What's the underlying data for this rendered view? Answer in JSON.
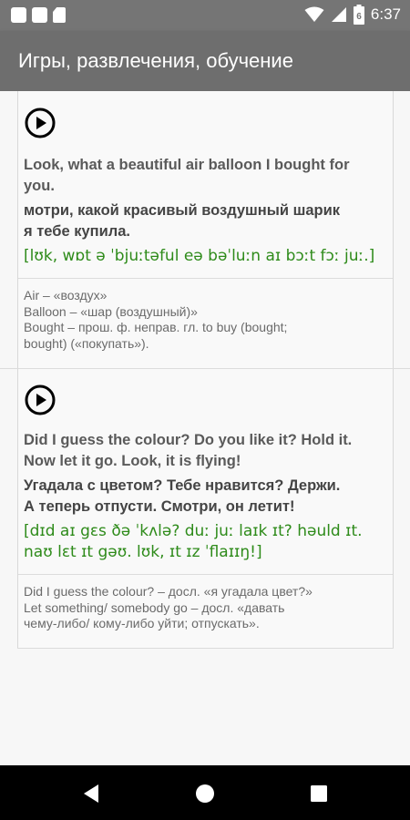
{
  "status_bar": {
    "time": "6:37",
    "battery_level": "6"
  },
  "app_bar": {
    "title": "Игры, развлечения, обучение"
  },
  "cards": [
    {
      "english_lines": [
        "Look, what a beautiful air balloon I bought for",
        "you."
      ],
      "russian_lines": [
        "мотри, какой красивый воздушный шарик",
        "я тебе купила."
      ],
      "transcription_lines": [
        "[lʊk, wɒt ə ˈbjuːtəful eə bəˈluːn aɪ bɔːt fɔː juː.]"
      ],
      "notes": [
        "Air – «воздух»",
        "Balloon – «шар (воздушный)»",
        "Bought – прош. ф. неправ. гл. to buy (bought;",
        "bought) («покупать»)."
      ]
    },
    {
      "english_lines": [
        "Did I guess the colour? Do you like it? Hold it.",
        "Now let it go. Look, it is flying!"
      ],
      "russian_lines": [
        "Угадала с цветом? Тебе нравится? Держи.",
        "А теперь отпусти. Смотри, он летит!"
      ],
      "transcription_lines": [
        "[dɪd aɪ gɛs ðə ˈkʌlə? duː juː laɪk ɪt? həuld ɪt.",
        "naʊ lɛt ɪt gəʊ. lʊk, ɪt ɪz ˈflaɪɪŋ!]"
      ],
      "notes": [
        "Did I guess the colour? – досл. «я угадала цвет?»",
        "Let something/ somebody go – досл. «давать",
        "чему-либо/ кому-либо уйти; отпускать»."
      ]
    }
  ],
  "nav": {
    "back_icon": "back-triangle-icon",
    "home_icon": "home-circle-icon",
    "recents_icon": "recents-square-icon"
  }
}
